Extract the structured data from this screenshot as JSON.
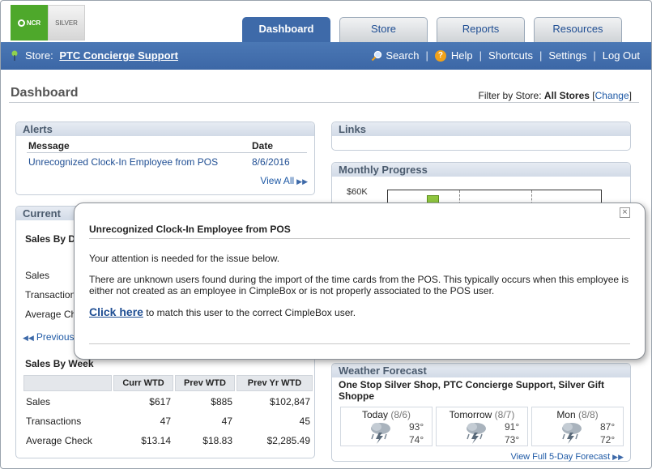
{
  "header": {
    "logo_primary": "NCR",
    "logo_secondary": "SILVER"
  },
  "tabs": [
    {
      "label": "Dashboard",
      "active": true
    },
    {
      "label": "Store",
      "active": false
    },
    {
      "label": "Reports",
      "active": false
    },
    {
      "label": "Resources",
      "active": false
    }
  ],
  "topbar": {
    "store_prefix": "Store:",
    "store_name": "PTC Concierge Support",
    "links": {
      "search": "Search",
      "help": "Help",
      "shortcuts": "Shortcuts",
      "settings": "Settings",
      "logout": "Log Out"
    },
    "separator": "|"
  },
  "page": {
    "title": "Dashboard",
    "filter_label": "Filter by Store:",
    "filter_value": "All Stores",
    "filter_change": "Change",
    "bracket_open": "[",
    "bracket_close": "]"
  },
  "alerts": {
    "title": "Alerts",
    "columns": [
      "Message",
      "Date"
    ],
    "rows": [
      {
        "message": "Unrecognized Clock-In Employee from POS",
        "date": "8/6/2016"
      }
    ],
    "view_all": "View All"
  },
  "links_panel": {
    "title": "Links"
  },
  "monthly_progress": {
    "title": "Monthly Progress",
    "y_tick": "$60K"
  },
  "current": {
    "title": "Current",
    "sales_by_day_label": "Sales By D",
    "row_labels": [
      "Sales",
      "Transaction",
      "Average Ch"
    ],
    "previous_link": "Previous D",
    "sales_by_week_title": "Sales By Week",
    "week_columns": [
      "",
      "Curr WTD",
      "Prev WTD",
      "Prev Yr WTD"
    ],
    "week_rows": [
      {
        "label": "Sales",
        "curr": "$617",
        "prev": "$885",
        "prev_yr": "$102,847"
      },
      {
        "label": "Transactions",
        "curr": "47",
        "prev": "47",
        "prev_yr": "45"
      },
      {
        "label": "Average Check",
        "curr": "$13.14",
        "prev": "$18.83",
        "prev_yr": "$2,285.49"
      }
    ]
  },
  "weather": {
    "title": "Weather Forecast",
    "stores": "One Stop Silver Shop, PTC Concierge Support, Silver Gift Shoppe",
    "days": [
      {
        "name": "Today",
        "date": "(8/6)",
        "hi": "93°",
        "lo": "74°"
      },
      {
        "name": "Tomorrow",
        "date": "(8/7)",
        "hi": "91°",
        "lo": "73°"
      },
      {
        "name": "Mon",
        "date": "(8/8)",
        "hi": "87°",
        "lo": "72°"
      }
    ],
    "forecast_link": "View Full 5-Day Forecast"
  },
  "modal": {
    "title": "Unrecognized Clock-In Employee from POS",
    "close": "×",
    "line1": "Your attention is needed for the issue below.",
    "line2": "There are unknown users found during the import of the time cards from the POS. This typically occurs when this employee is either not created as an employee in CimpleBox or is not properly associated to the POS user.",
    "link_text": "Click here",
    "link_suffix": " to match this user to the correct CimpleBox user."
  },
  "colors": {
    "brand_blue": "#3e6aa9",
    "ncr_green": "#4ea82b",
    "link_blue": "#1f4e93"
  }
}
